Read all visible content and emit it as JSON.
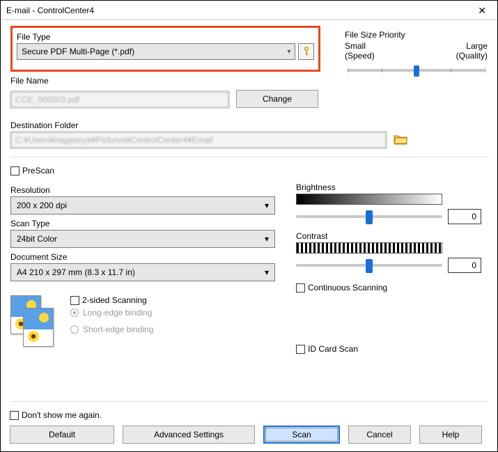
{
  "window": {
    "title": "E-mail - ControlCenter4"
  },
  "file_type": {
    "label": "File Type",
    "value": "Secure PDF Multi-Page (*.pdf)"
  },
  "file_size_priority": {
    "label": "File Size Priority",
    "left_top": "Small",
    "left_bottom": "(Speed)",
    "right_top": "Large",
    "right_bottom": "(Quality)",
    "position_pct": 50
  },
  "file_name": {
    "label": "File Name",
    "value": "CCE_000003.pdf",
    "change_label": "Change"
  },
  "destination": {
    "label": "Destination Folder",
    "value": "C:¥Users¥nagaseya¥Pictures¥ControlCenter4¥Email"
  },
  "prescan": {
    "label": "PreScan",
    "checked": false
  },
  "resolution": {
    "label": "Resolution",
    "value": "200 x 200 dpi"
  },
  "scan_type": {
    "label": "Scan Type",
    "value": "24bit Color"
  },
  "document_size": {
    "label": "Document Size",
    "value": "A4 210 x 297 mm (8.3 x 11.7 in)"
  },
  "brightness": {
    "label": "Brightness",
    "value": "0",
    "position_pct": 50
  },
  "contrast": {
    "label": "Contrast",
    "value": "0",
    "position_pct": 50
  },
  "continuous_scanning": {
    "label": "Continuous Scanning",
    "checked": false
  },
  "two_sided": {
    "label": "2-sided Scanning",
    "checked": false,
    "long_edge": "Long-edge binding",
    "short_edge": "Short-edge binding",
    "selected": "long"
  },
  "id_card_scan": {
    "label": "ID Card Scan",
    "checked": false
  },
  "dont_show": {
    "label": "Don't show me again.",
    "checked": false
  },
  "buttons": {
    "default": "Default",
    "advanced": "Advanced Settings",
    "scan": "Scan",
    "cancel": "Cancel",
    "help": "Help"
  }
}
